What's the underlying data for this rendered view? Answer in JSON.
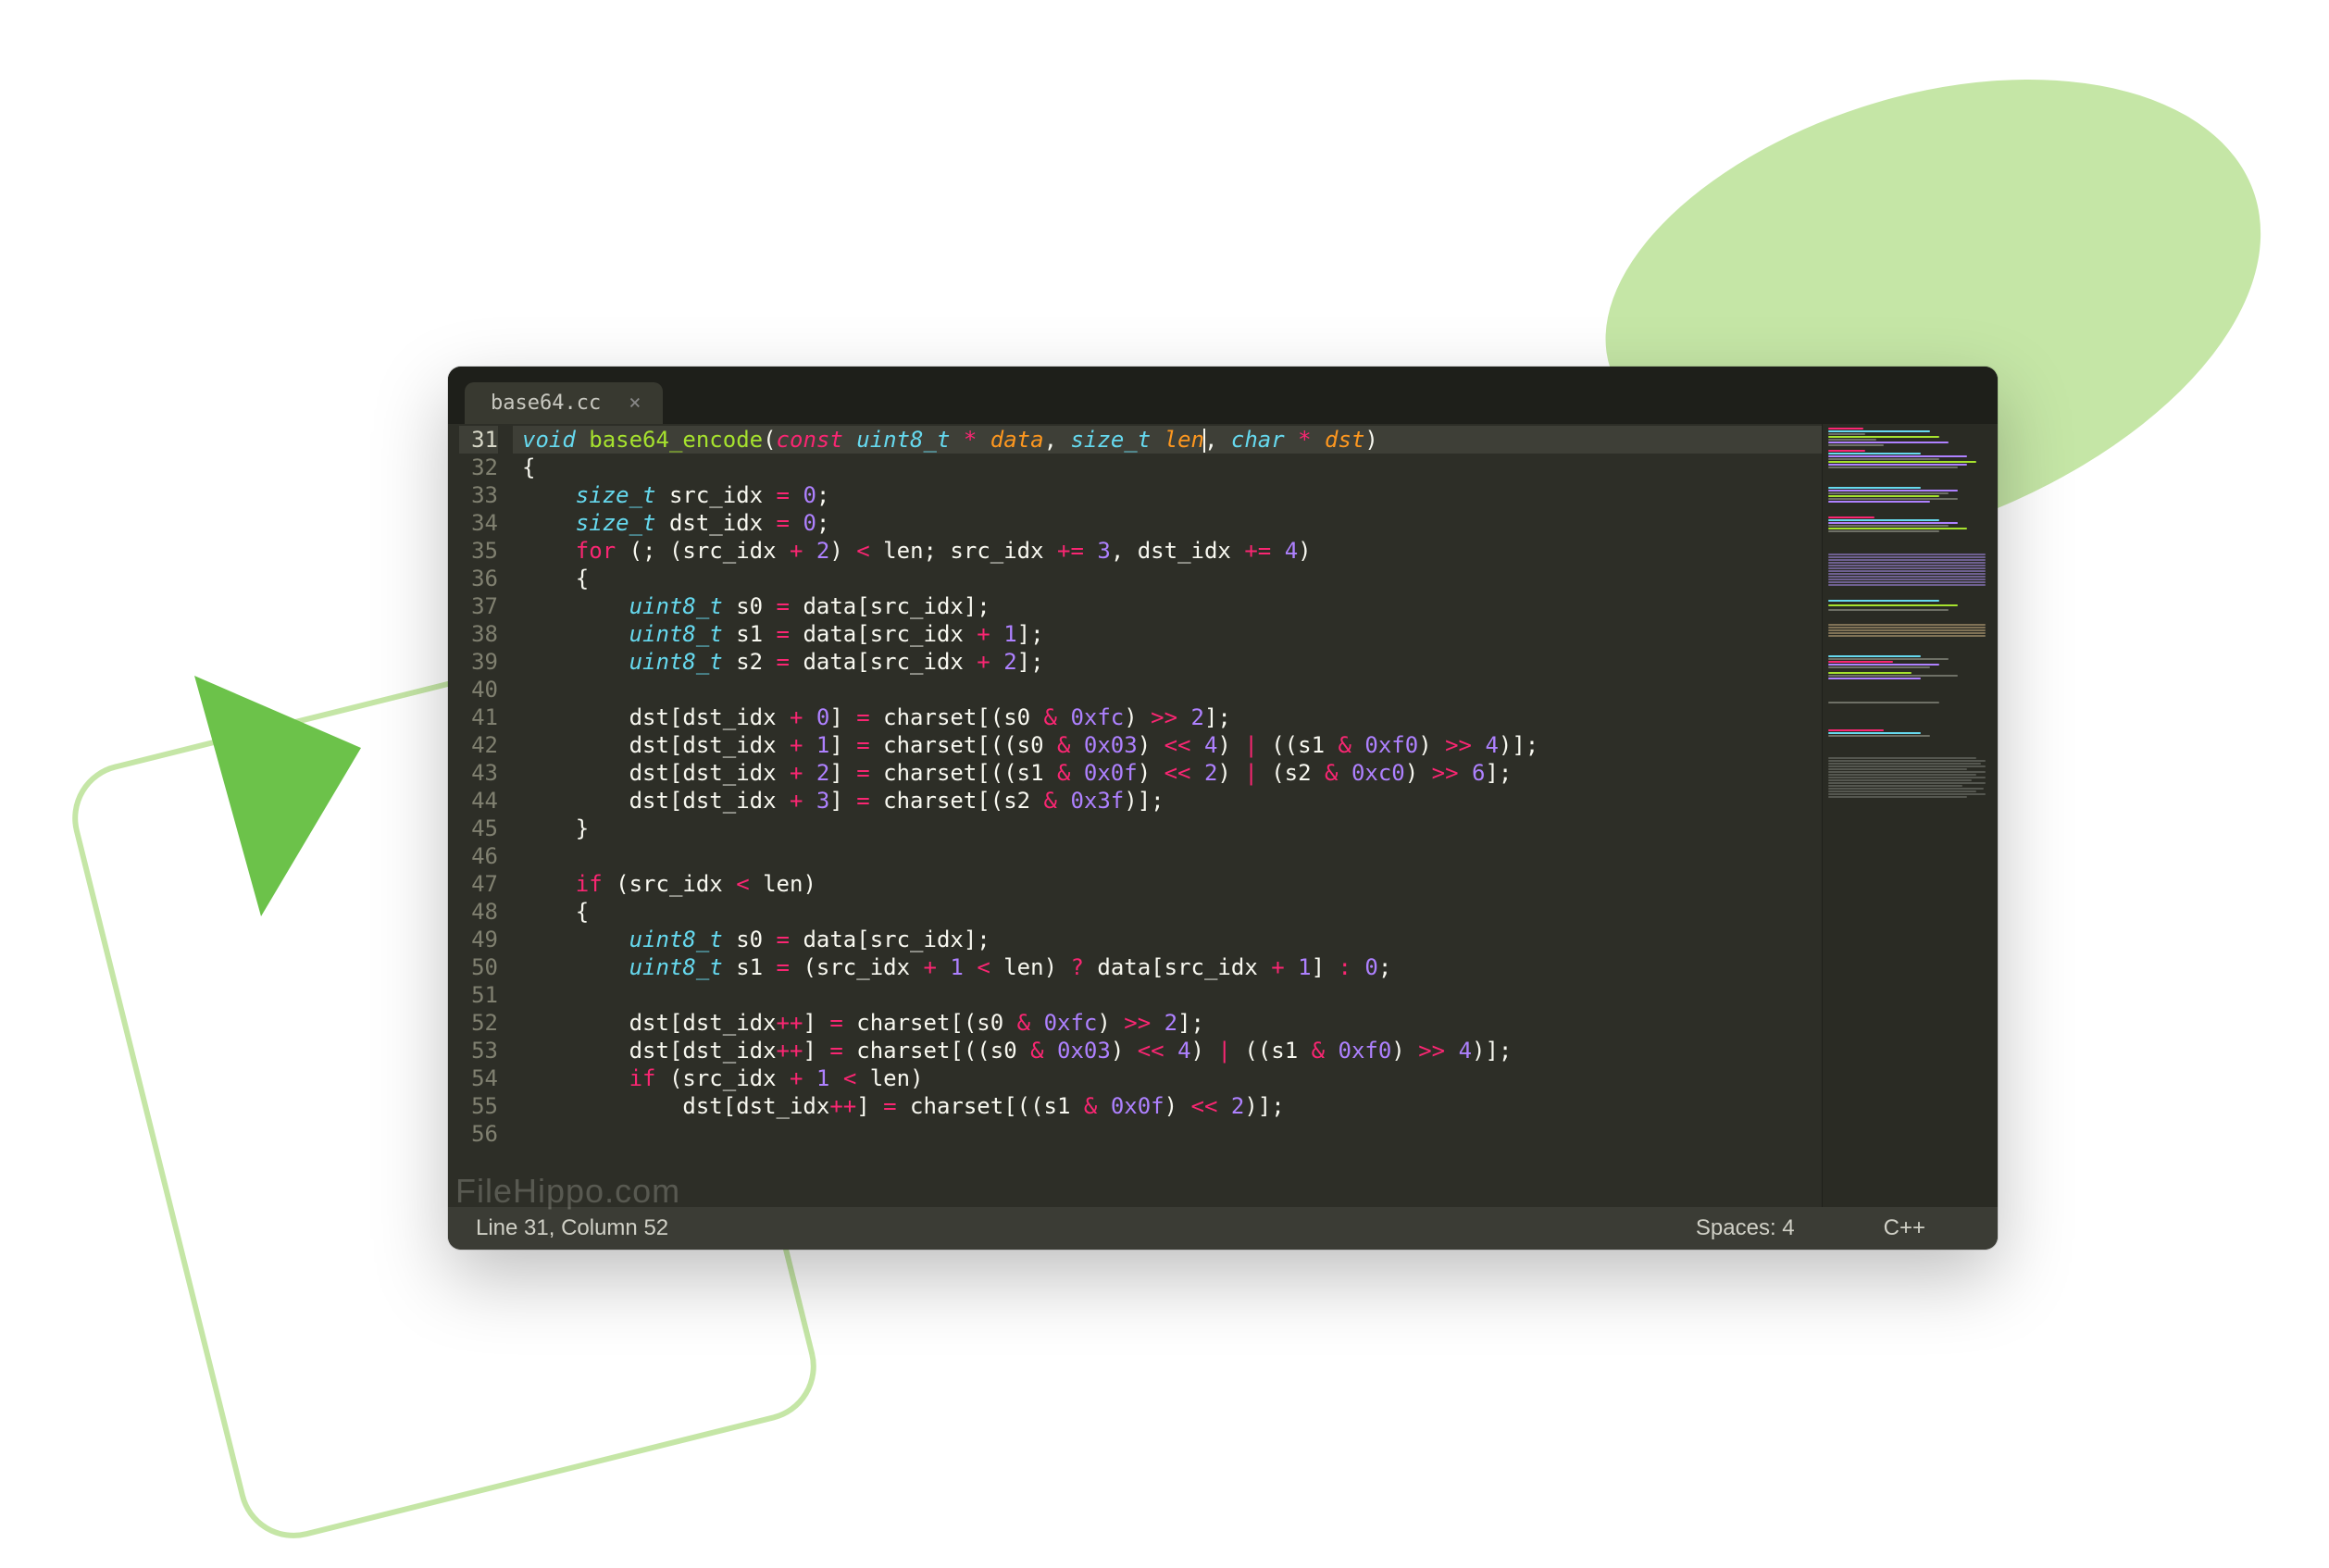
{
  "tab": {
    "filename": "base64.cc",
    "close_glyph": "×"
  },
  "status": {
    "position": "Line 31, Column 52",
    "spaces": "Spaces: 4",
    "syntax": "C++"
  },
  "watermark": "FileHippo.com",
  "gutter_start": 31,
  "gutter_end": 56,
  "active_line": 31,
  "code_lines": [
    {
      "n": 31,
      "html": "<span class='kw-storage'>void</span> <span class='fn'>base64_encode</span>(<span class='kw-ctrl'>const</span> <span class='kw-storage'>uint8_t</span> <span class='op'>*</span> <span class='param'>data</span>, <span class='kw-storage'>size_t</span> <span class='param'>len</span><span class='cursor'></span>, <span class='kw-storage'>char</span> <span class='op'>*</span> <span class='param'>dst</span>)"
    },
    {
      "n": 32,
      "html": "{"
    },
    {
      "n": 33,
      "html": "    <span class='kw-storage'>size_t</span> src_idx <span class='op'>=</span> <span class='num'>0</span>;"
    },
    {
      "n": 34,
      "html": "    <span class='kw-storage'>size_t</span> dst_idx <span class='op'>=</span> <span class='num'>0</span>;"
    },
    {
      "n": 35,
      "html": "    <span class='kw-flow'>for</span> (; (src_idx <span class='op'>+</span> <span class='num'>2</span>) <span class='op'>&lt;</span> len; src_idx <span class='op'>+=</span> <span class='num'>3</span>, dst_idx <span class='op'>+=</span> <span class='num'>4</span>)"
    },
    {
      "n": 36,
      "html": "    {"
    },
    {
      "n": 37,
      "html": "        <span class='kw-storage'>uint8_t</span> s0 <span class='op'>=</span> data[src_idx];"
    },
    {
      "n": 38,
      "html": "        <span class='kw-storage'>uint8_t</span> s1 <span class='op'>=</span> data[src_idx <span class='op'>+</span> <span class='num'>1</span>];"
    },
    {
      "n": 39,
      "html": "        <span class='kw-storage'>uint8_t</span> s2 <span class='op'>=</span> data[src_idx <span class='op'>+</span> <span class='num'>2</span>];"
    },
    {
      "n": 40,
      "html": ""
    },
    {
      "n": 41,
      "html": "        dst[dst_idx <span class='op'>+</span> <span class='num'>0</span>] <span class='op'>=</span> charset[(s0 <span class='op'>&amp;</span> <span class='num'>0xfc</span>) <span class='op'>&gt;&gt;</span> <span class='num'>2</span>];"
    },
    {
      "n": 42,
      "html": "        dst[dst_idx <span class='op'>+</span> <span class='num'>1</span>] <span class='op'>=</span> charset[((s0 <span class='op'>&amp;</span> <span class='num'>0x03</span>) <span class='op'>&lt;&lt;</span> <span class='num'>4</span>) <span class='op'>|</span> ((s1 <span class='op'>&amp;</span> <span class='num'>0xf0</span>) <span class='op'>&gt;&gt;</span> <span class='num'>4</span>)];"
    },
    {
      "n": 43,
      "html": "        dst[dst_idx <span class='op'>+</span> <span class='num'>2</span>] <span class='op'>=</span> charset[((s1 <span class='op'>&amp;</span> <span class='num'>0x0f</span>) <span class='op'>&lt;&lt;</span> <span class='num'>2</span>) <span class='op'>|</span> (s2 <span class='op'>&amp;</span> <span class='num'>0xc0</span>) <span class='op'>&gt;&gt;</span> <span class='num'>6</span>];"
    },
    {
      "n": 44,
      "html": "        dst[dst_idx <span class='op'>+</span> <span class='num'>3</span>] <span class='op'>=</span> charset[(s2 <span class='op'>&amp;</span> <span class='num'>0x3f</span>)];"
    },
    {
      "n": 45,
      "html": "    }"
    },
    {
      "n": 46,
      "html": ""
    },
    {
      "n": 47,
      "html": "    <span class='kw-flow'>if</span> (src_idx <span class='op'>&lt;</span> len)"
    },
    {
      "n": 48,
      "html": "    {"
    },
    {
      "n": 49,
      "html": "        <span class='kw-storage'>uint8_t</span> s0 <span class='op'>=</span> data[src_idx];"
    },
    {
      "n": 50,
      "html": "        <span class='kw-storage'>uint8_t</span> s1 <span class='op'>=</span> (src_idx <span class='op'>+</span> <span class='num'>1</span> <span class='op'>&lt;</span> len) <span class='op'>?</span> data[src_idx <span class='op'>+</span> <span class='num'>1</span>] <span class='op'>:</span> <span class='num'>0</span>;"
    },
    {
      "n": 51,
      "html": ""
    },
    {
      "n": 52,
      "html": "        dst[dst_idx<span class='op'>++</span>] <span class='op'>=</span> charset[(s0 <span class='op'>&amp;</span> <span class='num'>0xfc</span>) <span class='op'>&gt;&gt;</span> <span class='num'>2</span>];"
    },
    {
      "n": 53,
      "html": "        dst[dst_idx<span class='op'>++</span>] <span class='op'>=</span> charset[((s0 <span class='op'>&amp;</span> <span class='num'>0x03</span>) <span class='op'>&lt;&lt;</span> <span class='num'>4</span>) <span class='op'>|</span> ((s1 <span class='op'>&amp;</span> <span class='num'>0xf0</span>) <span class='op'>&gt;&gt;</span> <span class='num'>4</span>)];"
    },
    {
      "n": 54,
      "html": "        <span class='kw-flow'>if</span> (src_idx <span class='op'>+</span> <span class='num'>1</span> <span class='op'>&lt;</span> len)"
    },
    {
      "n": 55,
      "html": "            dst[dst_idx<span class='op'>++</span>] <span class='op'>=</span> charset[((s1 <span class='op'>&amp;</span> <span class='num'>0x0f</span>) <span class='op'>&lt;&lt;</span> <span class='num'>2</span>)];"
    },
    {
      "n": 56,
      "html": ""
    }
  ],
  "minimap_lines": [
    {
      "t": 4,
      "w": 38,
      "c": "#f92672"
    },
    {
      "t": 7,
      "w": 110,
      "c": "#66d9ef"
    },
    {
      "t": 10,
      "w": 40,
      "c": "#6e7066"
    },
    {
      "t": 13,
      "w": 120,
      "c": "#a6e22e"
    },
    {
      "t": 16,
      "w": 52,
      "c": "#6e7066"
    },
    {
      "t": 19,
      "w": 130,
      "c": "#ae81ff"
    },
    {
      "t": 22,
      "w": 60,
      "c": "#6e7066"
    },
    {
      "t": 28,
      "w": 40,
      "c": "#f92672"
    },
    {
      "t": 31,
      "w": 100,
      "c": "#66d9ef"
    },
    {
      "t": 34,
      "w": 150,
      "c": "#ae81ff"
    },
    {
      "t": 37,
      "w": 120,
      "c": "#6e7066"
    },
    {
      "t": 40,
      "w": 160,
      "c": "#a6e22e"
    },
    {
      "t": 43,
      "w": 150,
      "c": "#ae81ff"
    },
    {
      "t": 46,
      "w": 140,
      "c": "#6e7066"
    },
    {
      "t": 68,
      "w": 100,
      "c": "#66d9ef"
    },
    {
      "t": 71,
      "w": 140,
      "c": "#ae81ff"
    },
    {
      "t": 74,
      "w": 130,
      "c": "#6e7066"
    },
    {
      "t": 77,
      "w": 120,
      "c": "#a6e22e"
    },
    {
      "t": 80,
      "w": 140,
      "c": "#6e7066"
    },
    {
      "t": 83,
      "w": 110,
      "c": "#ae81ff"
    },
    {
      "t": 100,
      "w": 50,
      "c": "#f92672"
    },
    {
      "t": 103,
      "w": 120,
      "c": "#66d9ef"
    },
    {
      "t": 106,
      "w": 140,
      "c": "#ae81ff"
    },
    {
      "t": 109,
      "w": 130,
      "c": "#6e7066"
    },
    {
      "t": 112,
      "w": 150,
      "c": "#a6e22e"
    },
    {
      "t": 115,
      "w": 120,
      "c": "#6e7066"
    },
    {
      "t": 140,
      "w": 170,
      "c": "#6e6090"
    },
    {
      "t": 143,
      "w": 170,
      "c": "#6e6090"
    },
    {
      "t": 146,
      "w": 170,
      "c": "#6e6090"
    },
    {
      "t": 149,
      "w": 170,
      "c": "#6e6090"
    },
    {
      "t": 152,
      "w": 170,
      "c": "#6e6090"
    },
    {
      "t": 155,
      "w": 170,
      "c": "#6e6090"
    },
    {
      "t": 158,
      "w": 170,
      "c": "#6e6090"
    },
    {
      "t": 161,
      "w": 170,
      "c": "#6e6090"
    },
    {
      "t": 164,
      "w": 170,
      "c": "#6e6090"
    },
    {
      "t": 167,
      "w": 170,
      "c": "#6e6090"
    },
    {
      "t": 170,
      "w": 170,
      "c": "#6e6090"
    },
    {
      "t": 173,
      "w": 170,
      "c": "#6e6090"
    },
    {
      "t": 190,
      "w": 120,
      "c": "#66d9ef"
    },
    {
      "t": 195,
      "w": 140,
      "c": "#a6e22e"
    },
    {
      "t": 200,
      "w": 130,
      "c": "#6e7066"
    },
    {
      "t": 216,
      "w": 170,
      "c": "#807256"
    },
    {
      "t": 219,
      "w": 170,
      "c": "#807256"
    },
    {
      "t": 222,
      "w": 170,
      "c": "#807256"
    },
    {
      "t": 225,
      "w": 170,
      "c": "#807256"
    },
    {
      "t": 228,
      "w": 170,
      "c": "#807256"
    },
    {
      "t": 250,
      "w": 100,
      "c": "#66d9ef"
    },
    {
      "t": 253,
      "w": 130,
      "c": "#6e7066"
    },
    {
      "t": 256,
      "w": 70,
      "c": "#f92672"
    },
    {
      "t": 259,
      "w": 120,
      "c": "#ae81ff"
    },
    {
      "t": 262,
      "w": 110,
      "c": "#6e7066"
    },
    {
      "t": 268,
      "w": 90,
      "c": "#a6e22e"
    },
    {
      "t": 271,
      "w": 140,
      "c": "#6e7066"
    },
    {
      "t": 274,
      "w": 100,
      "c": "#ae81ff"
    },
    {
      "t": 300,
      "w": 120,
      "c": "#6e7066"
    },
    {
      "t": 330,
      "w": 60,
      "c": "#f92672"
    },
    {
      "t": 333,
      "w": 100,
      "c": "#66d9ef"
    },
    {
      "t": 336,
      "w": 110,
      "c": "#6e7066"
    },
    {
      "t": 360,
      "w": 160,
      "c": "#555750"
    },
    {
      "t": 363,
      "w": 170,
      "c": "#555750"
    },
    {
      "t": 366,
      "w": 165,
      "c": "#555750"
    },
    {
      "t": 369,
      "w": 170,
      "c": "#555750"
    },
    {
      "t": 372,
      "w": 150,
      "c": "#555750"
    },
    {
      "t": 375,
      "w": 170,
      "c": "#555750"
    },
    {
      "t": 378,
      "w": 160,
      "c": "#555750"
    },
    {
      "t": 381,
      "w": 170,
      "c": "#555750"
    },
    {
      "t": 384,
      "w": 155,
      "c": "#555750"
    },
    {
      "t": 387,
      "w": 170,
      "c": "#555750"
    },
    {
      "t": 390,
      "w": 145,
      "c": "#555750"
    },
    {
      "t": 393,
      "w": 168,
      "c": "#555750"
    },
    {
      "t": 396,
      "w": 160,
      "c": "#555750"
    },
    {
      "t": 399,
      "w": 170,
      "c": "#555750"
    },
    {
      "t": 402,
      "w": 150,
      "c": "#555750"
    }
  ]
}
